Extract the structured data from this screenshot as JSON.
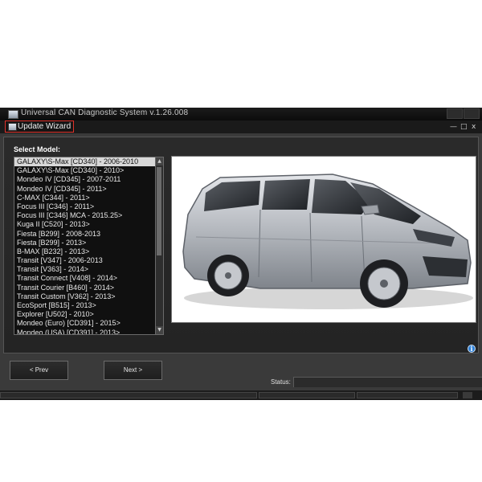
{
  "window": {
    "title": "Universal CAN Diagnostic System v.1.26.008",
    "title_controls": [
      "-",
      "□",
      "x"
    ]
  },
  "wizard": {
    "tab_label": "Update Wizard",
    "controls": [
      "—",
      "□",
      "x"
    ]
  },
  "main": {
    "select_label": "Select Model:",
    "models": [
      "GALAXY\\S-Max [CD340] - 2006-2010",
      "GALAXY\\S-Max [CD340] - 2010>",
      "Mondeo IV [CD345] - 2007-2011",
      "Mondeo IV [CD345] - 2011>",
      "C-MAX [C344] - 2011>",
      "Focus III [C346] - 2011>",
      "Focus III [C346] MCA - 2015.25>",
      "Kuga II [C520] - 2013>",
      "Fiesta [B299] - 2008-2013",
      "Fiesta [B299] - 2013>",
      "B-MAX [B232] - 2013>",
      "Transit [V347] - 2006-2013",
      "Transit [V363] - 2014>",
      "Transit Connect [V408] - 2014>",
      "Transit Courier [B460] - 2014>",
      "Transit Custom [V362] - 2013>",
      "EcoSport [B515] - 2013>",
      "Explorer [U502] - 2010>",
      "Mondeo (Euro) [CD391] - 2015>",
      "Mondeo (USA) [CD391] - 2013>"
    ],
    "selected_index": 0,
    "info_icon": "i",
    "car_color": "#b9bcc2"
  },
  "footer": {
    "prev_label": "< Prev",
    "next_label": "Next >",
    "status_label": "Status:",
    "status_value": ""
  }
}
